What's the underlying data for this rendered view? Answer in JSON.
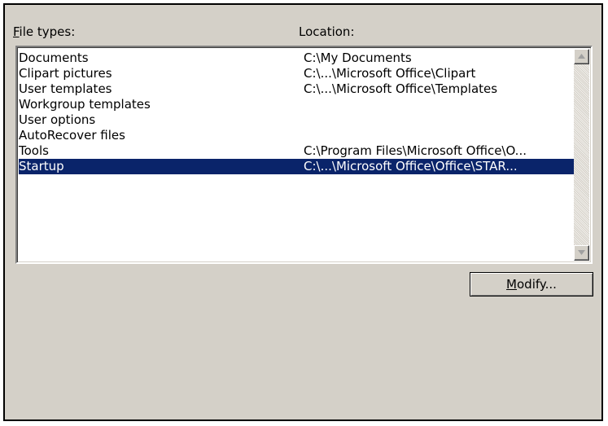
{
  "headers": {
    "file_types_accel": "F",
    "file_types_rest": "ile types:",
    "location": "Location:"
  },
  "list": {
    "selected_index": 7,
    "rows": [
      {
        "file_type": "Documents",
        "location": "C:\\My Documents"
      },
      {
        "file_type": "Clipart pictures",
        "location": "C:\\...\\Microsoft Office\\Clipart"
      },
      {
        "file_type": "User templates",
        "location": "C:\\...\\Microsoft Office\\Templates"
      },
      {
        "file_type": "Workgroup templates",
        "location": ""
      },
      {
        "file_type": "User options",
        "location": ""
      },
      {
        "file_type": "AutoRecover files",
        "location": ""
      },
      {
        "file_type": "Tools",
        "location": "C:\\Program Files\\Microsoft Office\\O..."
      },
      {
        "file_type": "Startup",
        "location": "C:\\...\\Microsoft Office\\Office\\STAR..."
      }
    ]
  },
  "scrollbar": {
    "up_icon": "arrow-up-icon",
    "down_icon": "arrow-down-icon"
  },
  "buttons": {
    "modify_accel": "M",
    "modify_rest": "odify..."
  },
  "colors": {
    "dialog_bg": "#d4d0c8",
    "selection_bg": "#0a246a",
    "selection_text": "#ffffff"
  }
}
